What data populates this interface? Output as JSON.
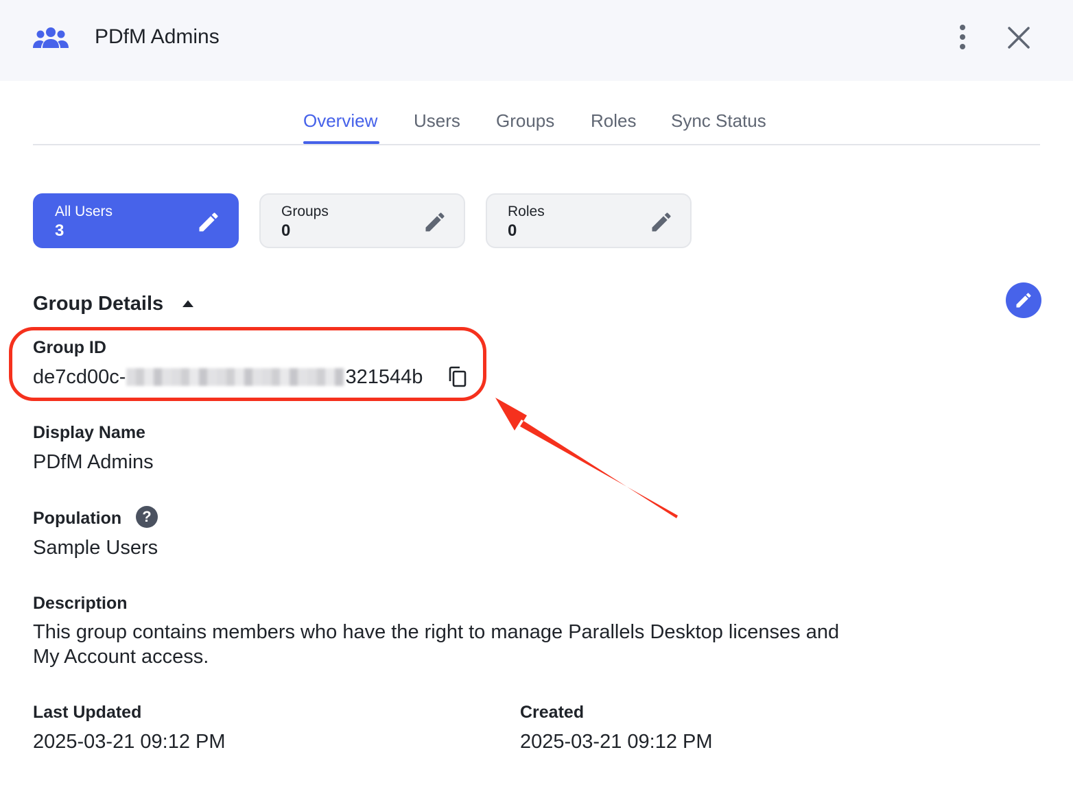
{
  "header": {
    "title": "PDfM Admins",
    "icon": "users-group-icon",
    "menu_icon": "kebab-menu-icon",
    "close_icon": "close-icon"
  },
  "tabs": [
    {
      "label": "Overview",
      "active": true
    },
    {
      "label": "Users",
      "active": false
    },
    {
      "label": "Groups",
      "active": false
    },
    {
      "label": "Roles",
      "active": false
    },
    {
      "label": "Sync Status",
      "active": false
    }
  ],
  "cards": [
    {
      "label": "All Users",
      "value": "3"
    },
    {
      "label": "Groups",
      "value": "0"
    },
    {
      "label": "Roles",
      "value": "0"
    }
  ],
  "details": {
    "title": "Group Details",
    "group_id_label": "Group ID",
    "group_id_prefix": "de7cd00c-",
    "group_id_suffix": "321544b",
    "display_name_label": "Display Name",
    "display_name_value": "PDfM Admins",
    "population_label": "Population",
    "population_help": "?",
    "population_value": "Sample Users",
    "description_label": "Description",
    "description_value": "This group contains members who have the right to manage Parallels Desktop licenses and My Account access.",
    "last_updated_label": "Last Updated",
    "last_updated_value": "2025-03-21 09:12 PM",
    "created_label": "Created",
    "created_value": "2025-03-21 09:12 PM"
  },
  "colors": {
    "accent": "#4763ea",
    "header_bg": "#f6f7fb",
    "annotation": "#f5311d"
  }
}
